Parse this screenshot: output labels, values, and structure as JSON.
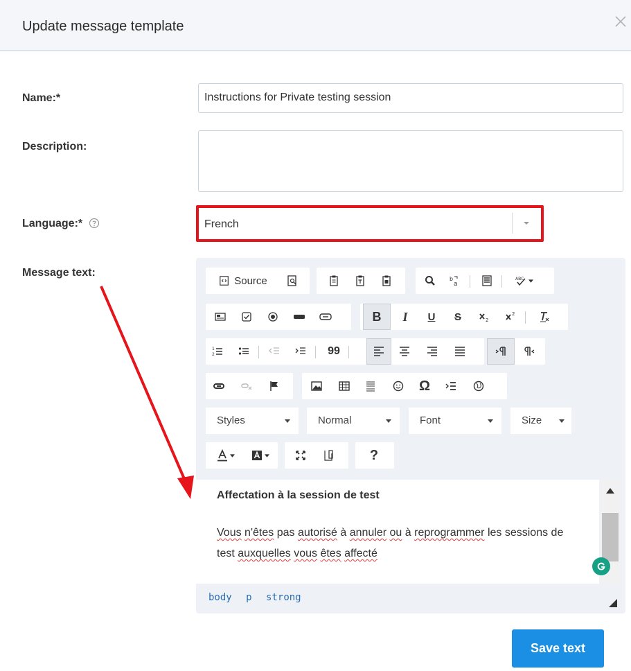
{
  "dialog": {
    "title": "Update message template"
  },
  "form": {
    "name_label": "Name:*",
    "name_value": "Instructions for Private testing session",
    "description_label": "Description:",
    "description_value": "",
    "language_label": "Language:*",
    "language_value": "French",
    "message_label": "Message text:"
  },
  "editor": {
    "source_label": "Source",
    "italic_glyph": "I",
    "bold_glyph": "B",
    "underline_glyph": "U",
    "strike_glyph": "S",
    "blockquote_glyph": "99",
    "omega_glyph": "Ω",
    "help_glyph": "?",
    "styles_label": "Styles",
    "format_label": "Normal",
    "font_label": "Font",
    "size_label": "Size",
    "content_heading": "Affectation à la session de test",
    "para_words": {
      "w1": "Vous",
      "w2": "n'êtes",
      "w3": "pas",
      "w4": "autorisé",
      "w5": "à",
      "w6": "annuler",
      "w7": "ou",
      "w8": "à",
      "w9": "reprogrammer",
      "w10": "les",
      "w11": "sessions de test",
      "w12": "auxquelles",
      "w13": "vous",
      "w14": "êtes",
      "w15": "affecté"
    },
    "path": [
      "body",
      "p",
      "strong"
    ]
  },
  "actions": {
    "save_label": "Save text"
  },
  "colors": {
    "accent": "#1a8fe3",
    "highlight_border": "#e6141b",
    "annotation_arrow": "#e6141b"
  }
}
